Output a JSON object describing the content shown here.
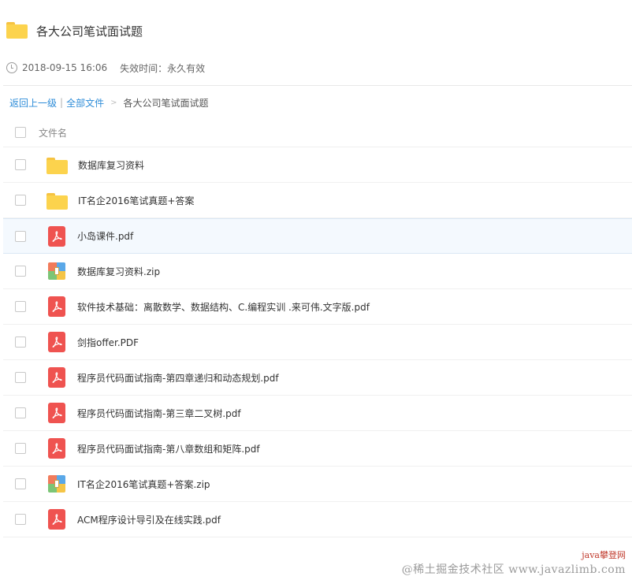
{
  "share": {
    "title": "各大公司笔试面试题",
    "created": "2018-09-15 16:06",
    "expire": "失效时间：永久有效"
  },
  "breadcrumb": {
    "back": "返回上一级",
    "sep": "|",
    "all": "全部文件",
    "gt": ">",
    "current": "各大公司笔试面试题"
  },
  "list": {
    "header_label": "文件名",
    "files": [
      {
        "name": "数据库复习资料",
        "type": "folder"
      },
      {
        "name": "IT名企2016笔试真题+答案",
        "type": "folder"
      },
      {
        "name": "小岛课件.pdf",
        "type": "pdf"
      },
      {
        "name": "数据库复习资料.zip",
        "type": "zip"
      },
      {
        "name": "软件技术基础：离散数学、数据结构、C.编程实训 .来可伟.文字版.pdf",
        "type": "pdf"
      },
      {
        "name": "剑指offer.PDF",
        "type": "pdf"
      },
      {
        "name": "程序员代码面试指南-第四章递归和动态规划.pdf",
        "type": "pdf"
      },
      {
        "name": "程序员代码面试指南-第三章二叉树.pdf",
        "type": "pdf"
      },
      {
        "name": "程序员代码面试指南-第八章数组和矩阵.pdf",
        "type": "pdf"
      },
      {
        "name": "IT名企2016笔试真题+答案.zip",
        "type": "zip"
      },
      {
        "name": "ACM程序设计导引及在线实践.pdf",
        "type": "pdf"
      }
    ]
  },
  "watermark": {
    "line1": "java攀登网",
    "line2": "@稀土掘金技术社区 www.javazlimb.com"
  },
  "colors": {
    "link": "#2d8cd8",
    "folder": "#fcd34d",
    "pdf": "#ef5350",
    "row_hover_bg": "#f4f9fe"
  }
}
